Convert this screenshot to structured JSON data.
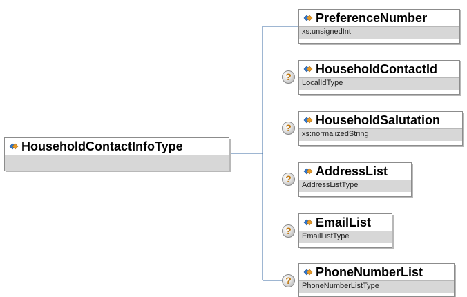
{
  "root": {
    "name": "HouseholdContactInfoType"
  },
  "children": [
    {
      "name": "PreferenceNumber",
      "type": "xs:unsignedInt",
      "optional": false
    },
    {
      "name": "HouseholdContactId",
      "type": "LocalIdType",
      "optional": true
    },
    {
      "name": "HouseholdSalutation",
      "type": "xs:normalizedString",
      "optional": true
    },
    {
      "name": "AddressList",
      "type": "AddressListType",
      "optional": true
    },
    {
      "name": "EmailList",
      "type": "EmailListType",
      "optional": true
    },
    {
      "name": "PhoneNumberList",
      "type": "PhoneNumberListType",
      "optional": true
    }
  ],
  "optional_marker": "?",
  "colors": {
    "line": "#3c6ea5",
    "type_bar": "#d7d7d7",
    "border": "#8c8c8c",
    "icon_blue": "#2f78d0",
    "icon_orange": "#e69a28"
  }
}
